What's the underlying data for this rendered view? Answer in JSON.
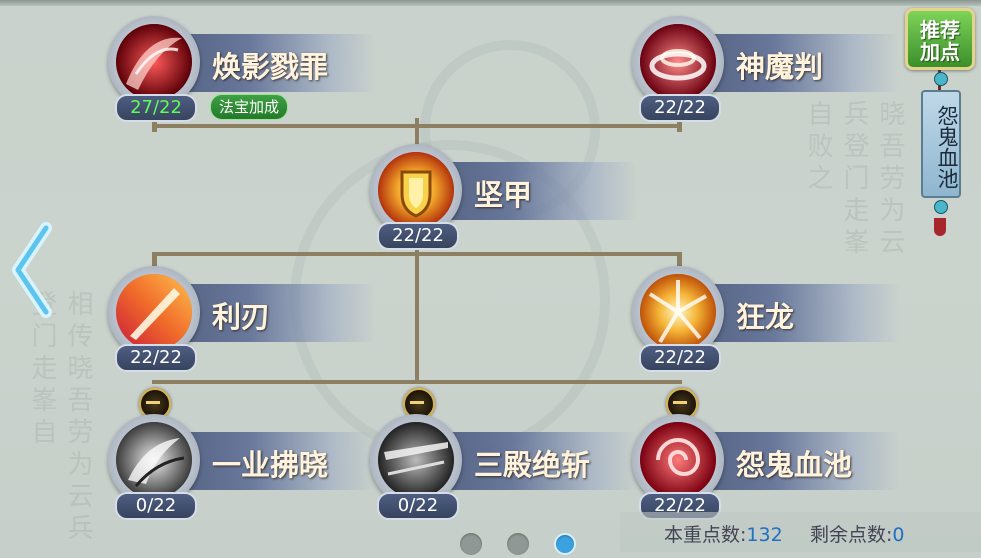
{
  "buttons": {
    "recommend": "推荐\n加点",
    "side_tab": "怨鬼血池"
  },
  "skills": [
    {
      "name": "焕影戮罪",
      "count": "27/22",
      "badge": "法宝加成"
    },
    {
      "name": "神魔判",
      "count": "22/22"
    },
    {
      "name": "坚甲",
      "count": "22/22"
    },
    {
      "name": "利刃",
      "count": "22/22"
    },
    {
      "name": "狂龙",
      "count": "22/22"
    },
    {
      "name": "一业拂晓",
      "count": "0/22"
    },
    {
      "name": "三殿绝斩",
      "count": "0/22"
    },
    {
      "name": "怨鬼血池",
      "count": "22/22"
    }
  ],
  "points": {
    "invested_label": "本重点数:",
    "invested_value": "132",
    "remaining_label": "剩余点数:",
    "remaining_value": "0"
  },
  "pagination": {
    "total": 3,
    "current": 3
  },
  "background_text": "相传晓吾劳为云兵登门走峯自败之",
  "colors": {
    "count_bonus": "#5dff52",
    "accent": "#3aa3df",
    "connector": "#8c7f62"
  },
  "icons": [
    "crimson-slash-icon",
    "vortex-icon",
    "shield-icon",
    "blade-icon",
    "dragon-burst-icon",
    "gray-dawn-icon",
    "gray-slash-icon",
    "blood-pool-icon",
    "left-arrow-icon"
  ]
}
